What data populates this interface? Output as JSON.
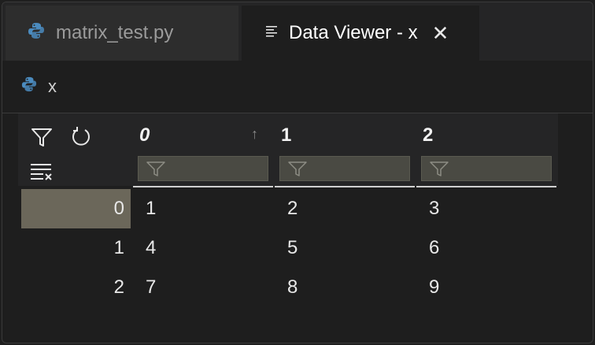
{
  "tabs": [
    {
      "label": "matrix_test.py",
      "icon": "python-icon",
      "active": false
    },
    {
      "label": "Data Viewer - x",
      "icon": "lines-icon",
      "active": true
    }
  ],
  "breadcrumb": {
    "label": "x",
    "icon": "python-icon"
  },
  "grid": {
    "columns": [
      "0",
      "1",
      "2"
    ],
    "rows": [
      {
        "index": "0",
        "cells": [
          "1",
          "2",
          "3"
        ]
      },
      {
        "index": "1",
        "cells": [
          "4",
          "5",
          "6"
        ]
      },
      {
        "index": "2",
        "cells": [
          "7",
          "8",
          "9"
        ]
      }
    ]
  },
  "colors": {
    "accent_python_blue": "#4b8bbe",
    "accent_python_yellow": "#ffd43b",
    "selected_row": "#6b675a"
  }
}
